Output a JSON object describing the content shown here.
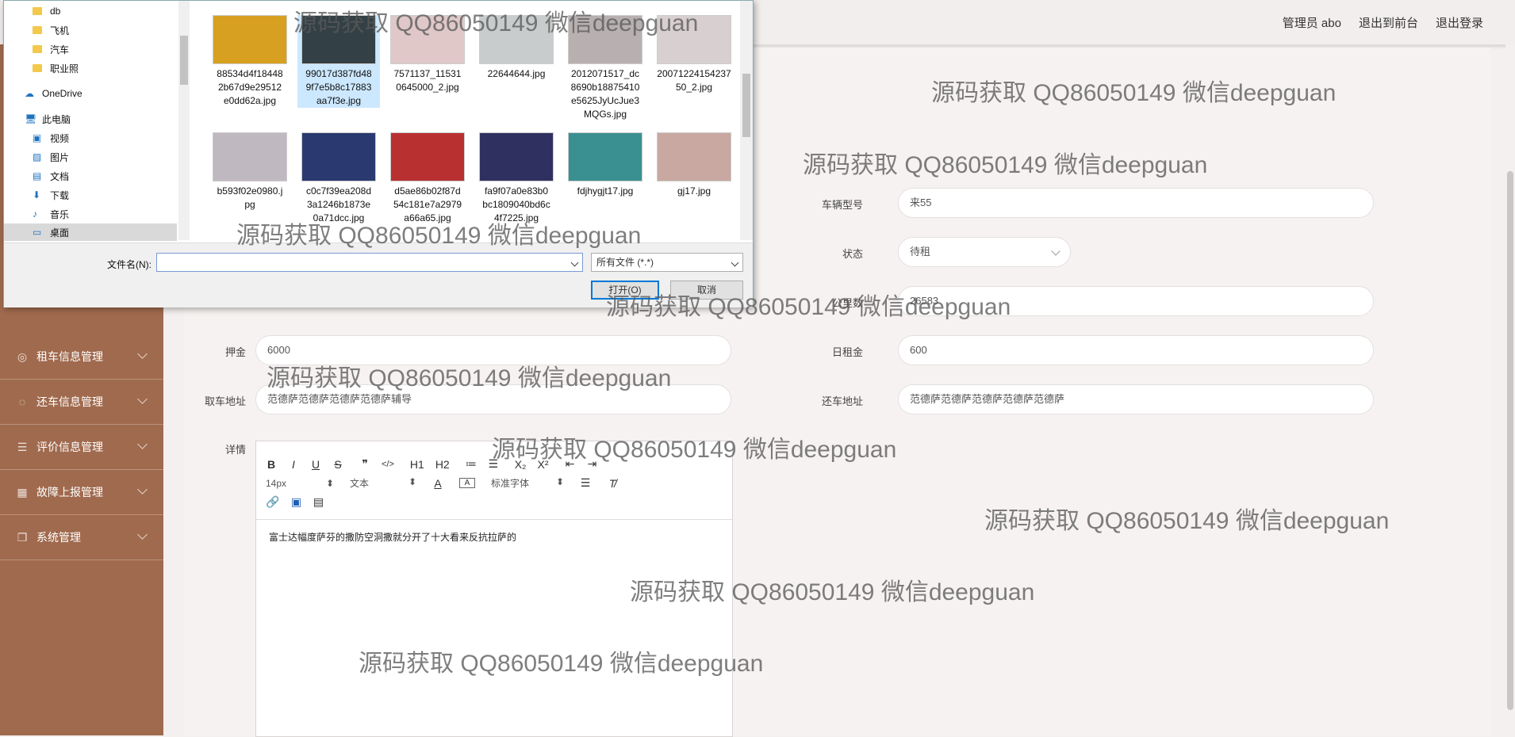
{
  "header": {
    "admin_label": "管理员 abo",
    "to_frontend": "退出到前台",
    "logout": "退出登录"
  },
  "sidebar": {
    "items": [
      {
        "label": "租车信息管理",
        "icon": "car-icon"
      },
      {
        "label": "还车信息管理",
        "icon": "return-icon"
      },
      {
        "label": "评价信息管理",
        "icon": "list-icon"
      },
      {
        "label": "故障上报管理",
        "icon": "grid-icon"
      },
      {
        "label": "系统管理",
        "icon": "copy-icon"
      }
    ]
  },
  "form": {
    "model_label": "车辆型号",
    "model_value": "来55",
    "status_label": "状态",
    "status_value": "待租",
    "mileage_label": "公里数",
    "mileage_value": "26583",
    "deposit_label": "押金",
    "deposit_value": "6000",
    "daily_label": "日租金",
    "daily_value": "600",
    "pickup_label": "取车地址",
    "pickup_value": "范德萨范德萨范德萨范德萨辅导",
    "return_label": "还车地址",
    "return_value": "范德萨范德萨范德萨范德萨范德萨",
    "detail_label": "详情"
  },
  "editor": {
    "row1": [
      "B",
      "I",
      "U",
      "S",
      "❞",
      "</>",
      "H1",
      "H2",
      "≔",
      "☰",
      "X₂",
      "X²",
      "⇤",
      "⇥"
    ],
    "size": "14px",
    "text_style": "文本",
    "font": "标准字体",
    "content": "富士达幅度萨芬的撒防空洞撒就分开了十大看来反抗拉萨的"
  },
  "dialog": {
    "tree": [
      {
        "label": "db",
        "icon": "folder-icon"
      },
      {
        "label": "飞机",
        "icon": "folder-icon"
      },
      {
        "label": "汽车",
        "icon": "folder-icon"
      },
      {
        "label": "职业照",
        "icon": "folder-icon"
      },
      {
        "label": "OneDrive",
        "icon": "cloud-icon"
      },
      {
        "label": "此电脑",
        "icon": "computer-icon"
      },
      {
        "label": "视频",
        "icon": "video-icon"
      },
      {
        "label": "图片",
        "icon": "picture-icon"
      },
      {
        "label": "文档",
        "icon": "document-icon"
      },
      {
        "label": "下载",
        "icon": "download-icon"
      },
      {
        "label": "音乐",
        "icon": "music-icon"
      },
      {
        "label": "桌面",
        "icon": "desktop-icon"
      }
    ],
    "files": [
      {
        "name": "88534d4f184482b67d9e29512e0dd62a.jpg",
        "lines": [
          "88534d4f18448",
          "2b67d9e29512",
          "e0dd62a.jpg"
        ],
        "color": "#d8a020"
      },
      {
        "name": "99017d387fd489f7e5b8c17883aa7f3e.jpg",
        "lines": [
          "99017d387fd48",
          "9f7e5b8c17883",
          "aa7f3e.jpg"
        ],
        "color": "#334045"
      },
      {
        "name": "7571137_115310645000_2.jpg",
        "lines": [
          "7571137_11531",
          "0645000_2.jpg"
        ],
        "color": "#e0c8c8"
      },
      {
        "name": "22644644.jpg",
        "lines": [
          "22644644.jpg"
        ],
        "color": "#c8cccc"
      },
      {
        "name": "2012071517_dc8690b18875410e5625JyUcJue3MQGs.jpg",
        "lines": [
          "2012071517_dc",
          "8690b18875410",
          "e5625JyUcJue3",
          "MQGs.jpg"
        ],
        "color": "#b8b0b0"
      },
      {
        "name": "20071224154237502.jpg",
        "lines": [
          "20071224154237",
          "50_2.jpg"
        ],
        "color": "#d8d0d0"
      },
      {
        "name": "b593f02e0980.jpg",
        "lines": [
          "b593f02e0980.j",
          "pg"
        ],
        "color": "#c0b8c0"
      },
      {
        "name": "c0c7f39ea208d3a1246b1873e0a71dcc.jpg",
        "lines": [
          "c0c7f39ea208d",
          "3a1246b1873e",
          "0a71dcc.jpg"
        ],
        "color": "#2a3a70"
      },
      {
        "name": "d5ae86b02f87d54c181e7a2979a66a65.jpg",
        "lines": [
          "d5ae86b02f87d",
          "54c181e7a2979",
          "a66a65.jpg"
        ],
        "color": "#b83030"
      },
      {
        "name": "fa9f07a0e83b0bc1809040bd6c4f7225.jpg",
        "lines": [
          "fa9f07a0e83b0",
          "bc1809040bd6c",
          "4f7225.jpg"
        ],
        "color": "#303060"
      },
      {
        "name": "fdjhygjt17.jpg",
        "lines": [
          "fdjhygjt17.jpg"
        ],
        "color": "#3a9090"
      },
      {
        "name": "gj17.jpg",
        "lines": [
          "gj17.jpg"
        ],
        "color": "#c8a8a0"
      }
    ],
    "filename_label": "文件名(N):",
    "filename_value": "",
    "filetype": "所有文件 (*.*)",
    "open_button": "打开(O)",
    "cancel_button": "取消"
  },
  "watermark": "源码获取 QQ86050149 微信deepguan"
}
